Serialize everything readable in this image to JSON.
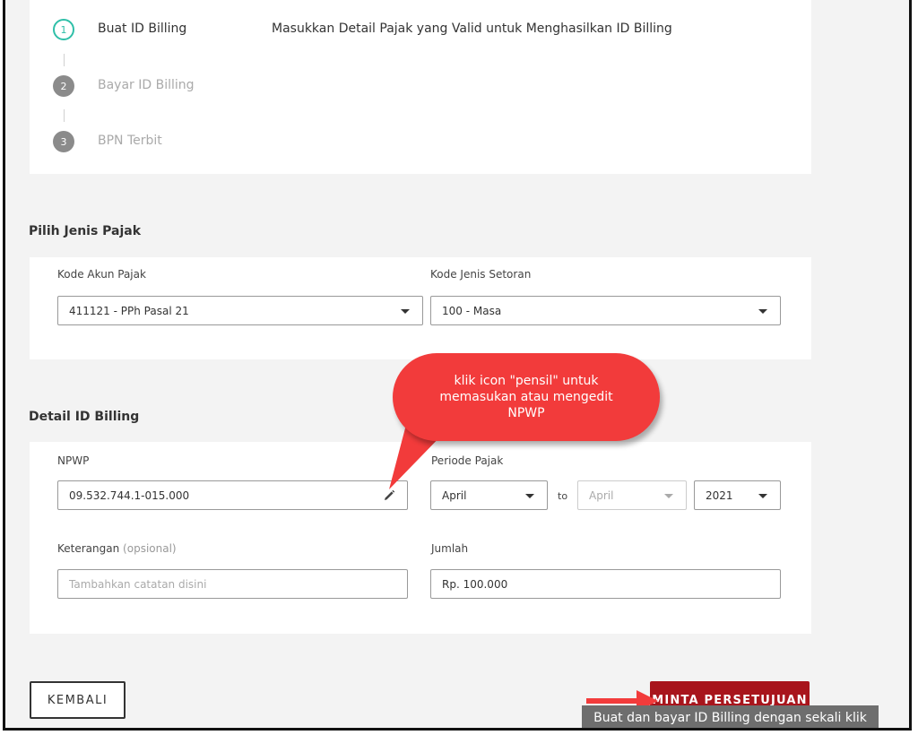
{
  "stepper": {
    "title": "Masukkan Detail Pajak yang Valid untuk Menghasilkan ID Billing",
    "steps": [
      {
        "number": "1",
        "label": "Buat ID Billing"
      },
      {
        "number": "2",
        "label": "Bayar ID Billing"
      },
      {
        "number": "3",
        "label": "BPN Terbit"
      }
    ]
  },
  "jenis_pajak": {
    "section_title": "Pilih Jenis Pajak",
    "kode_akun_label": "Kode Akun Pajak",
    "kode_akun_value": "411121 - PPh Pasal 21",
    "kode_setoran_label": "Kode Jenis Setoran",
    "kode_setoran_value": "100 - Masa"
  },
  "detail": {
    "section_title": "Detail ID Billing",
    "npwp_label": "NPWP",
    "npwp_value": "09.532.744.1-015.000",
    "periode_label": "Periode Pajak",
    "periode_from": "April",
    "periode_to_label": "to",
    "periode_to": "April",
    "periode_year": "2021",
    "keterangan_label": "Keterangan",
    "keterangan_optional": "(opsional)",
    "keterangan_placeholder": "Tambahkan catatan disini",
    "jumlah_label": "Jumlah",
    "jumlah_value": "Rp. 100.000"
  },
  "actions": {
    "back_label": "KEMBALI",
    "submit_label": "MINTA PERSETUJUAN",
    "tooltip": "Buat dan bayar ID Billing dengan sekali klik"
  },
  "annotation": {
    "callout_text": "klik icon \"pensil\" untuk memasukan atau mengedit NPWP"
  },
  "colors": {
    "accent_teal": "#2fbfa8",
    "primary_red": "#a8151c",
    "callout_red": "#f23b3b"
  }
}
